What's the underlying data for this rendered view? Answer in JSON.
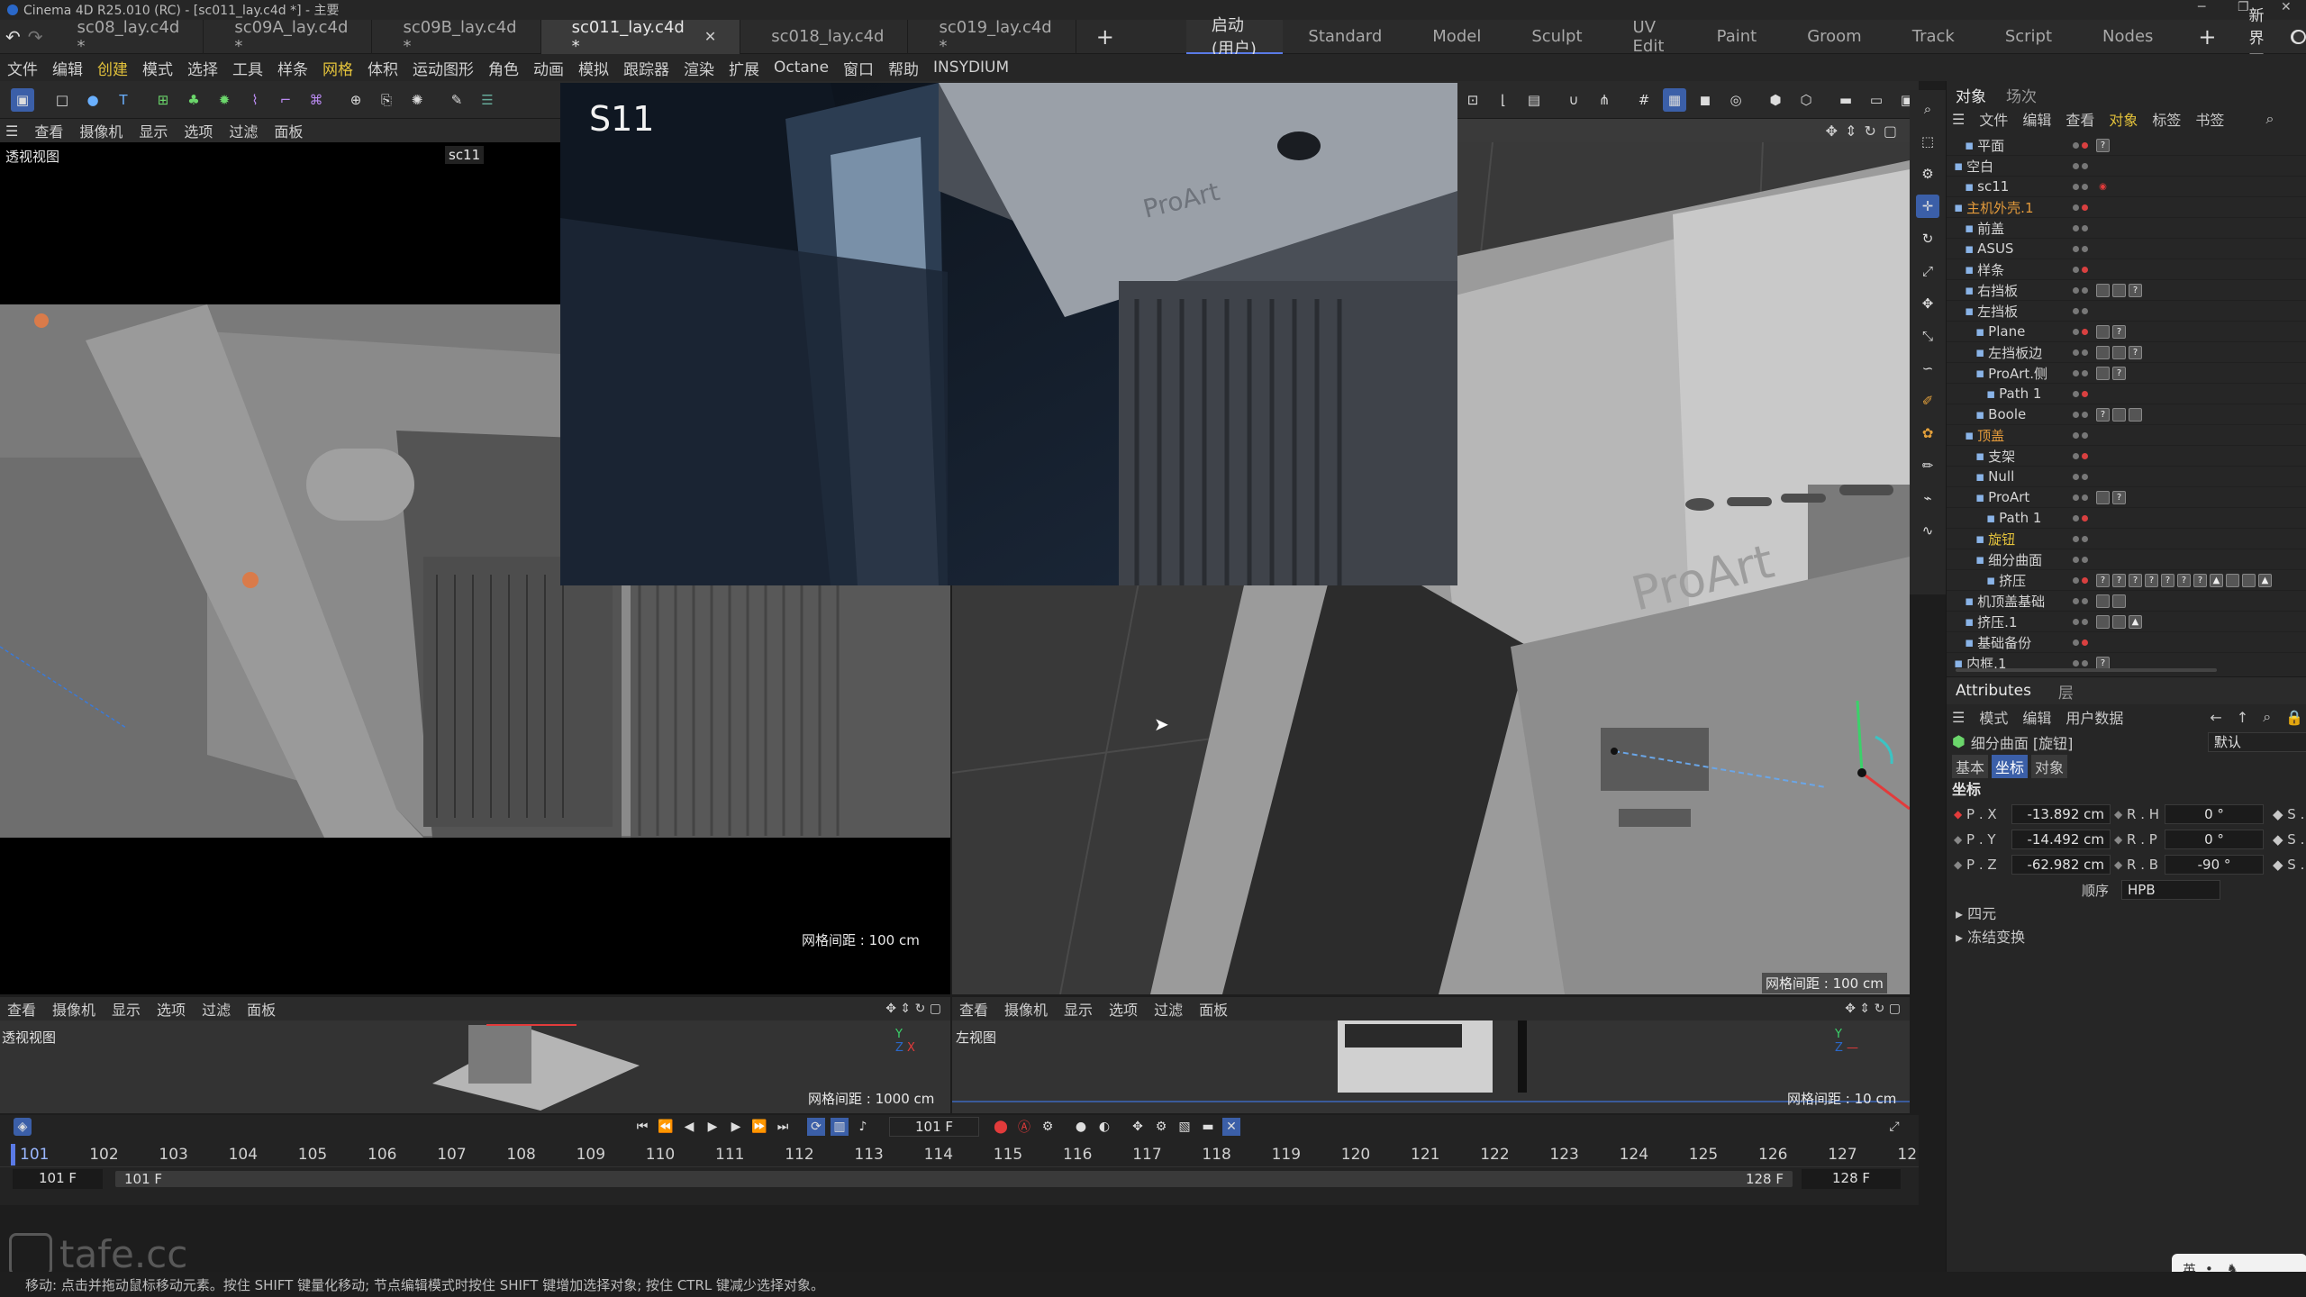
{
  "title_bar": {
    "text": "Cinema 4D R25.010 (RC) - [sc011_lay.c4d *] - 主要"
  },
  "file_tabs": [
    {
      "label": "sc08_lay.c4d *"
    },
    {
      "label": "sc09A_lay.c4d *"
    },
    {
      "label": "sc09B_lay.c4d *"
    },
    {
      "label": "sc011_lay.c4d *"
    },
    {
      "label": "sc018_lay.c4d"
    },
    {
      "label": "sc019_lay.c4d *"
    }
  ],
  "add_tab": "+",
  "layout_tabs": [
    "启动 (用户)",
    "Standard",
    "Model",
    "Sculpt",
    "UV Edit",
    "Paint",
    "Groom",
    "Track",
    "Script",
    "Nodes"
  ],
  "new_interface": "新界面",
  "menu": [
    "文件",
    "编辑",
    "创建",
    "模式",
    "选择",
    "工具",
    "样条",
    "网格",
    "体积",
    "运动图形",
    "角色",
    "动画",
    "模拟",
    "跟踪器",
    "渲染",
    "扩展",
    "Octane",
    "窗口",
    "帮助",
    "INSYDIUM"
  ],
  "viewport_menu": [
    "查看",
    "摄像机",
    "显示",
    "选项",
    "过滤",
    "面板"
  ],
  "viewports": {
    "top_left": {
      "label": "透视视图",
      "camera": "sc11",
      "grid": "网格间距 : 100 cm"
    },
    "top_right": {
      "grid": "网格间距 : 100 cm",
      "product_text": "ProArt"
    },
    "bottom_left": {
      "label": "透视视图",
      "grid": "网格间距 : 1000 cm"
    },
    "bottom_right": {
      "label": "左视图",
      "grid": "网格间距 : 10 cm"
    }
  },
  "overlay": {
    "label": "S11",
    "brand": "ProArt"
  },
  "object_manager": {
    "tabs": [
      "对象",
      "场次"
    ],
    "menu": [
      "文件",
      "编辑",
      "查看",
      "对象",
      "标签",
      "书签"
    ],
    "items": [
      {
        "name": "平面",
        "indent": 1,
        "color": "#d4d4d4",
        "tags": [
          "?"
        ]
      },
      {
        "name": "空白",
        "indent": 0,
        "color": "#d4d4d4",
        "tags": []
      },
      {
        "name": "sc11",
        "indent": 1,
        "color": "#d4d4d4",
        "tags": [
          "cam"
        ]
      },
      {
        "name": "主机外壳.1",
        "indent": 0,
        "color": "#e39a3b",
        "tags": []
      },
      {
        "name": "前盖",
        "indent": 1,
        "color": "#d4d4d4",
        "tags": []
      },
      {
        "name": "ASUS",
        "indent": 1,
        "color": "#d4d4d4",
        "tags": []
      },
      {
        "name": "样条",
        "indent": 1,
        "color": "#d4d4d4",
        "tags": []
      },
      {
        "name": "右挡板",
        "indent": 1,
        "color": "#d4d4d4",
        "tags": [
          "t",
          "t",
          "?"
        ]
      },
      {
        "name": "左挡板",
        "indent": 1,
        "color": "#d4d4d4",
        "tags": []
      },
      {
        "name": "Plane",
        "indent": 2,
        "color": "#d4d4d4",
        "tags": [
          "t",
          "?"
        ]
      },
      {
        "name": "左挡板边",
        "indent": 2,
        "color": "#d4d4d4",
        "tags": [
          "t",
          "t",
          "?"
        ]
      },
      {
        "name": "ProArt.侧",
        "indent": 2,
        "color": "#d4d4d4",
        "tags": [
          "t",
          "?"
        ]
      },
      {
        "name": "Path 1",
        "indent": 3,
        "color": "#d4d4d4",
        "tags": []
      },
      {
        "name": "Boole",
        "indent": 2,
        "color": "#d4d4d4",
        "tags": [
          "?",
          "t",
          "t"
        ]
      },
      {
        "name": "顶盖",
        "indent": 1,
        "color": "#e39a3b",
        "tags": []
      },
      {
        "name": "支架",
        "indent": 2,
        "color": "#d4d4d4",
        "tags": []
      },
      {
        "name": "Null",
        "indent": 2,
        "color": "#d4d4d4",
        "tags": []
      },
      {
        "name": "ProArt",
        "indent": 2,
        "color": "#d4d4d4",
        "tags": [
          "t",
          "?"
        ]
      },
      {
        "name": "Path 1",
        "indent": 3,
        "color": "#d4d4d4",
        "tags": []
      },
      {
        "name": "旋钮",
        "indent": 2,
        "color": "#e3c23b",
        "tags": []
      },
      {
        "name": "细分曲面",
        "indent": 2,
        "color": "#d4d4d4",
        "tags": []
      },
      {
        "name": "挤压",
        "indent": 3,
        "color": "#d4d4d4",
        "tags": [
          "?",
          "?",
          "?",
          "?",
          "?",
          "?",
          "?",
          "▲",
          "t",
          "t",
          "▲"
        ]
      },
      {
        "name": "机顶盖基础",
        "indent": 1,
        "color": "#d4d4d4",
        "tags": [
          "t",
          "t"
        ]
      },
      {
        "name": "挤压.1",
        "indent": 1,
        "color": "#d4d4d4",
        "tags": [
          "t",
          "t",
          "▲"
        ]
      },
      {
        "name": "基础备份",
        "indent": 1,
        "color": "#d4d4d4",
        "tags": []
      },
      {
        "name": "内框.1",
        "indent": 0,
        "color": "#d4d4d4",
        "tags": [
          "?"
        ]
      }
    ]
  },
  "attributes": {
    "tabs": [
      "Attributes",
      "层"
    ],
    "menu": [
      "模式",
      "编辑",
      "用户数据"
    ],
    "object_name": "细分曲面 [旋钮]",
    "preset": "默认",
    "sub_tabs": [
      "基本",
      "坐标",
      "对象"
    ],
    "section": "坐标",
    "fields": [
      {
        "label": "P . X",
        "value": "-13.892 cm",
        "rlabel": "R . H",
        "rvalue": "0 °"
      },
      {
        "label": "P . Y",
        "value": "-14.492 cm",
        "rlabel": "R . P",
        "rvalue": "0 °"
      },
      {
        "label": "P . Z",
        "value": "-62.982 cm",
        "rlabel": "R . B",
        "rvalue": "-90 °"
      }
    ],
    "order_label": "顺序",
    "order_value": "HPB",
    "groups": [
      "四元",
      "冻结变换"
    ]
  },
  "timeline": {
    "current_frame": "101 F",
    "ruler": [
      "101",
      "102",
      "103",
      "104",
      "105",
      "106",
      "107",
      "108",
      "109",
      "110",
      "111",
      "112",
      "113",
      "114",
      "115",
      "116",
      "117",
      "118",
      "119",
      "120",
      "121",
      "122",
      "123",
      "124",
      "125",
      "126",
      "127",
      "12"
    ],
    "start_field": "101 F",
    "range_start": "101 F",
    "range_end": "128 F",
    "end_field": "128 F"
  },
  "status": "移动: 点击并拖动鼠标移动元素。按住 SHIFT 键量化移动; 节点编辑模式时按住 SHIFT 键增加选择对象; 按住 CTRL 键减少选择对象。",
  "watermark": "tafe.cc",
  "ime": "英"
}
